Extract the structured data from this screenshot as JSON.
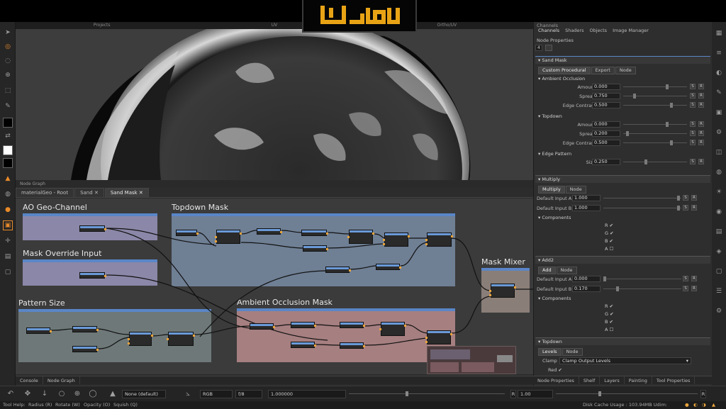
{
  "logo": {
    "text": "تيلو"
  },
  "viewport_tabs": [
    "Projects",
    "UV",
    "Ortho/UV"
  ],
  "node_graph": {
    "header": "Node Graph",
    "tabs": [
      {
        "label": "materialGeo - Root"
      },
      {
        "label": "Sand"
      },
      {
        "label": "Sand Mask",
        "active": true
      }
    ],
    "frames": {
      "ao_geo": "AO Geo-Channel",
      "topdown": "Topdown Mask",
      "mask_override": "Mask Override Input",
      "pattern_size": "Pattern Size",
      "ao_mask": "Ambient Occlusion Mask",
      "mask_mixer": "Mask Mixer"
    }
  },
  "bottom_tabs": [
    "Console",
    "Node Graph"
  ],
  "right_panel": {
    "header": "Channels",
    "tabs": [
      "Channels",
      "Shaders",
      "Objects",
      "Image Manager"
    ],
    "node_properties": "Node Properties",
    "field_value": "4",
    "sand_mask": {
      "title": "Sand Mask",
      "tabs": [
        "Custom Procedural",
        "Export",
        "Node"
      ],
      "ambient_occlusion": {
        "label": "Ambient Occlusion",
        "amount_label": "Amount",
        "amount": "0.000",
        "spread_label": "Spread",
        "spread": "0.750",
        "edge_label": "Edge Contrast",
        "edge": "0.500"
      },
      "topdown": {
        "label": "Topdown",
        "amount_label": "Amount",
        "amount": "0.000",
        "spread_label": "Spread",
        "spread": "0.200",
        "edge_label": "Edge Contrast",
        "edge": "0.500"
      },
      "edge_pattern": {
        "label": "Edge Pattern",
        "size_label": "Size",
        "size": "0.250"
      }
    },
    "multiply": {
      "title": "Multiply",
      "tabs": [
        "Multiply",
        "Node"
      ],
      "input_a_label": "Default Input A",
      "input_a": "1.000",
      "input_b_label": "Default Input B",
      "input_b": "1.000",
      "components": "Components",
      "comp": [
        "R",
        "G",
        "B",
        "A"
      ]
    },
    "add2": {
      "title": "Add2",
      "tabs": [
        "Add",
        "Node"
      ],
      "input_a_label": "Default Input A",
      "input_a": "0.000",
      "input_b_label": "Default Input B",
      "input_b": "0.170",
      "components": "Components",
      "comp": [
        "R",
        "G",
        "B",
        "A"
      ]
    },
    "topdown_sec": {
      "title": "Topdown",
      "tabs": [
        "Levels",
        "Node"
      ],
      "clamp_label": "Clamp",
      "clamp_value": "Clamp Output Levels",
      "red_label": "Red"
    },
    "bottom_tabs": [
      "Node Properties",
      "Shelf",
      "Layers",
      "Painting",
      "Tool Properties"
    ]
  },
  "toolbar": {
    "preset": "None (default)",
    "color_mode": "RGB",
    "fstop": "f/8",
    "exposure": "1.000000",
    "zoom_right": "1.00"
  },
  "status": {
    "tool_help_label": "Tool Help:",
    "radius": "Radius (R)",
    "rotate": "Rotate (W)",
    "opacity": "Opacity (O)",
    "squish": "Squish (Q)",
    "disk_cache": "Disk Cache Usage : 103.94MB Udim:"
  },
  "colors": {
    "frame_purple": "#8b87a8",
    "frame_blue_grey": "#6f7f94",
    "frame_teal_grey": "#6e7878",
    "frame_pink": "#a67f80",
    "frame_tan": "#8a7e78",
    "node_accent": "#5a86c7",
    "port_orange": "#e8a33a",
    "logo_gold": "#e8a315"
  }
}
